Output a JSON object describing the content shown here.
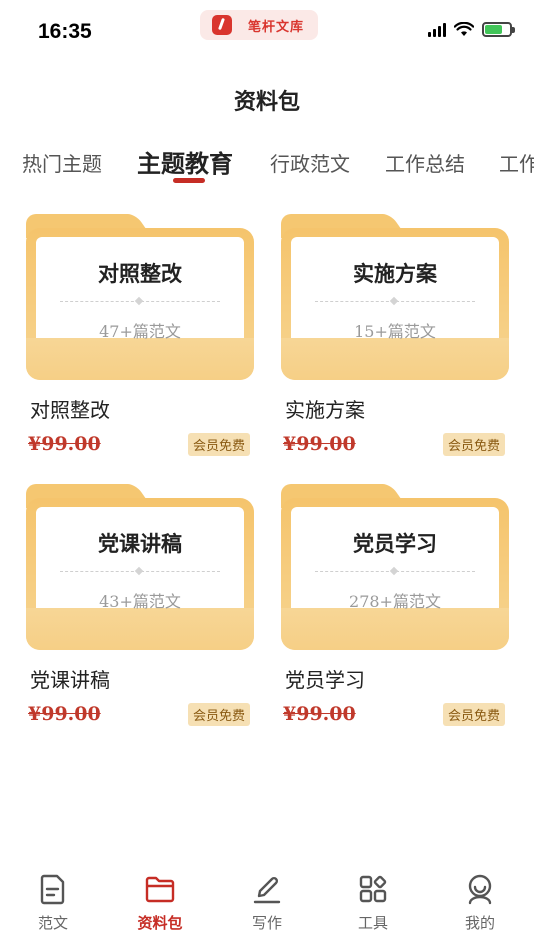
{
  "status_bar": {
    "time": "16:35",
    "app_name": "笔杆文库",
    "battery_color": "#42c559"
  },
  "header": {
    "title": "资料包"
  },
  "tabs": [
    {
      "label": "热门主题",
      "active": false
    },
    {
      "label": "主题教育",
      "active": true
    },
    {
      "label": "行政范文",
      "active": false
    },
    {
      "label": "工作总结",
      "active": false
    },
    {
      "label": "工作",
      "active": false
    }
  ],
  "cards": [
    {
      "folder_title": "对照整改",
      "count": "47+篇范文",
      "name": "对照整改",
      "price": "¥99.00",
      "badge": "会员免费"
    },
    {
      "folder_title": "实施方案",
      "count": "15+篇范文",
      "name": "实施方案",
      "price": "¥99.00",
      "badge": "会员免费"
    },
    {
      "folder_title": "党课讲稿",
      "count": "43+篇范文",
      "name": "党课讲稿",
      "price": "¥99.00",
      "badge": "会员免费"
    },
    {
      "folder_title": "党员学习",
      "count": "278+篇范文",
      "name": "党员学习",
      "price": "¥99.00",
      "badge": "会员免费"
    }
  ],
  "bottom_nav": [
    {
      "label": "范文",
      "icon": "document-icon",
      "active": false
    },
    {
      "label": "资料包",
      "icon": "folder-icon",
      "active": true
    },
    {
      "label": "写作",
      "icon": "pen-icon",
      "active": false
    },
    {
      "label": "工具",
      "icon": "grid-icon",
      "active": false
    },
    {
      "label": "我的",
      "icon": "profile-icon",
      "active": false
    }
  ],
  "colors": {
    "accent": "#c62d25",
    "folder": "#f5c771",
    "price": "#c0392b",
    "badge_bg": "#f6e0b4"
  }
}
